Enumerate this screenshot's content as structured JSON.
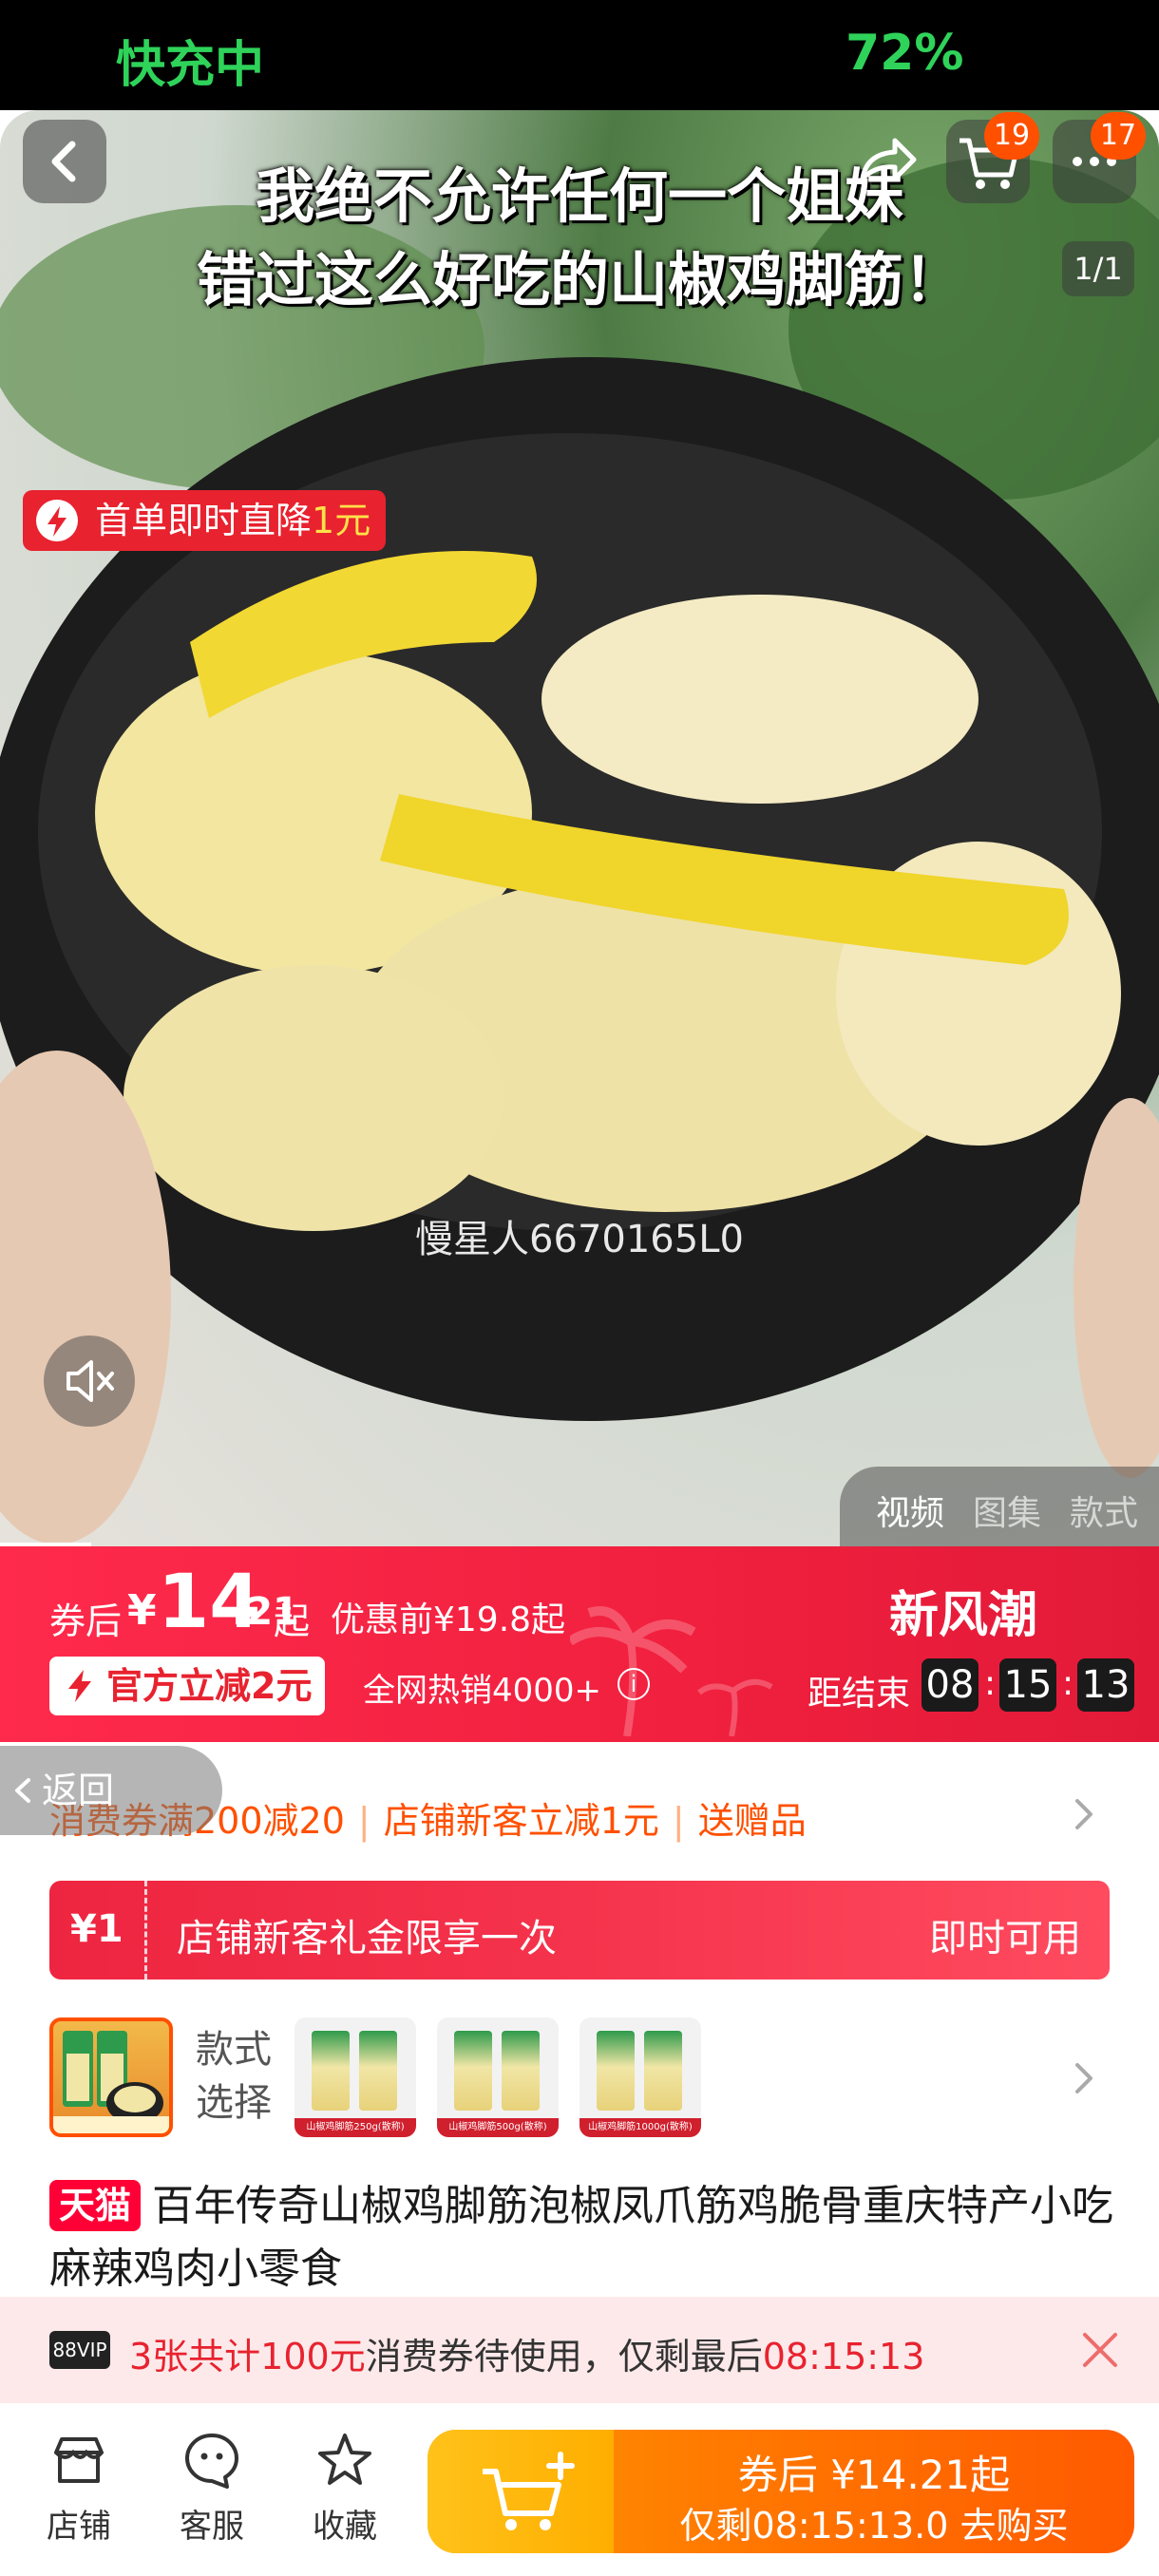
{
  "status": {
    "charging": "快充中",
    "battery": "72%"
  },
  "hero": {
    "caption_line1": "我绝不允许任何一个姐妹",
    "caption_line2": "错过这么好吃的山椒鸡脚筋！",
    "cart_count": "19",
    "more_count": "17",
    "page_indicator": "1/1",
    "promo_prefix": "首单即时直降",
    "promo_amount": "1元",
    "watermark": "慢星人6670165L0",
    "media_tabs": [
      "视频",
      "图集",
      "款式"
    ],
    "active_media_tab": "视频",
    "icons": [
      "back-icon",
      "share-icon",
      "cart-icon",
      "more-icon",
      "mute-icon",
      "lightning-icon"
    ]
  },
  "price": {
    "after_label": "券后",
    "currency": "¥",
    "integer": "14",
    "decimal": ".21",
    "from": "起",
    "before": "优惠前¥19.8起",
    "official_cut": "官方立减2元",
    "hot_sales": "全网热销4000+",
    "event": "新风潮",
    "ends_label": "距结束",
    "countdown": [
      "08",
      "15",
      "13"
    ],
    "colors": {
      "banner": "#f0203e",
      "countdown_box": "#1a1a1a"
    }
  },
  "coupons": {
    "back_label": "返回",
    "items": [
      "消费券满200减20",
      "店铺新客立减1元",
      "送赠品"
    ],
    "new_customer": {
      "amount": "¥1",
      "text": "店铺新客礼金限享一次",
      "status": "即时可用"
    }
  },
  "sku": {
    "label": "款式选择",
    "options": [
      "山椒鸡脚筋250g(散称)",
      "山椒鸡脚筋500g(散称)",
      "山椒鸡脚筋1000g(散称)"
    ]
  },
  "product": {
    "tag": "天猫",
    "title": "百年传奇山椒鸡脚筋泡椒凤爪筋鸡脆骨重庆特产小吃麻辣鸡肉小零食"
  },
  "vip": {
    "tag": "88VIP",
    "highlight": "3张共计100元",
    "text": "消费券待使用，仅剩最后",
    "countdown": "08:15:13"
  },
  "bottom": {
    "store": "店铺",
    "service": "客服",
    "favorite": "收藏",
    "buy_line1": "券后 ¥14.21起",
    "buy_line2": "仅剩08:15:13.0 去购买",
    "accent": "#ff5a00"
  }
}
